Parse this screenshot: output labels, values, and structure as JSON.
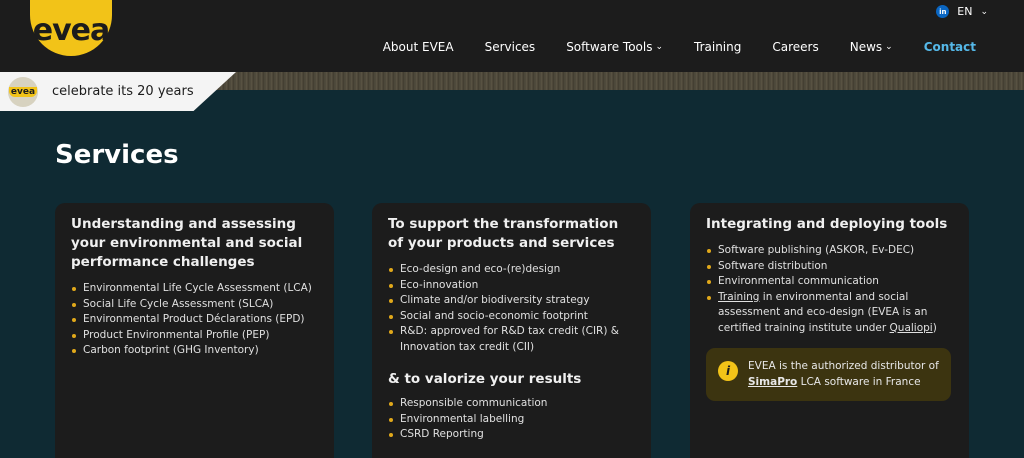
{
  "header": {
    "logo_text": "evea",
    "lang": "EN",
    "linkedin_label": "in",
    "nav": [
      {
        "label": "About EVEA"
      },
      {
        "label": "Services"
      },
      {
        "label": "Software Tools"
      },
      {
        "label": "Training"
      },
      {
        "label": "Careers"
      },
      {
        "label": "News"
      },
      {
        "label": "Contact"
      }
    ]
  },
  "badge": {
    "logo_text": "evea",
    "text": "celebrate its 20 years"
  },
  "page": {
    "title": "Services"
  },
  "cards": [
    {
      "title": "Understanding and assessing your environmental and social performance challenges",
      "items": [
        "Environmental Life Cycle Assessment (LCA)",
        "Social Life Cycle Assessment (SLCA)",
        "Environmental Product Déclarations (EPD)",
        "Product Environmental Profile (PEP)",
        "Carbon footprint (GHG Inventory)"
      ]
    },
    {
      "title": "To support the transformation of your products and services",
      "items": [
        "Eco-design and eco-(re)design",
        "Eco-innovation",
        "Climate and/or biodiversity strategy",
        "Social and socio-economic footprint",
        "R&D: approved for R&D tax credit (CIR) & Innovation tax credit (CII)"
      ],
      "subtitle": "& to valorize your results",
      "items2": [
        "Responsible communication",
        "Environmental labelling",
        "CSRD Reporting"
      ]
    },
    {
      "title": "Integrating and deploying tools",
      "items": [
        "Software publishing (ASKOR, Ev-DEC)",
        "Software distribution",
        "Environmental communication"
      ],
      "training_link": "Training",
      "training_rest": " in environmental and social assessment and eco-design (EVEA is an certified training institute under ",
      "qualiopi": "Qualiopi",
      "training_end": ")",
      "info": {
        "icon": "i",
        "pre": "EVEA is the authorized distributor of ",
        "link": "SimaPro",
        "post": " LCA software in France"
      }
    }
  ]
}
